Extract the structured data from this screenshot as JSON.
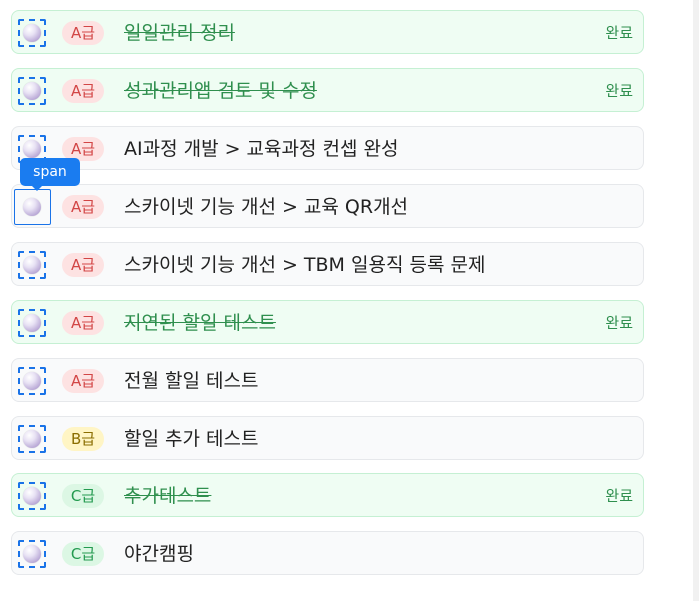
{
  "tooltip": "span",
  "tasks": [
    {
      "grade": "A급",
      "title": "일일관리 정리",
      "status": "완료",
      "done": true
    },
    {
      "grade": "A급",
      "title": "성과관리앱 검토 및 수정",
      "status": "완료",
      "done": true
    },
    {
      "grade": "A급",
      "title": "AI과정 개발 > 교육과정 컨셉 완성",
      "status": "",
      "done": false
    },
    {
      "grade": "A급",
      "title": "스카이넷 기능 개선 > 교육 QR개선",
      "status": "",
      "done": false
    },
    {
      "grade": "A급",
      "title": "스카이넷 기능 개선 > TBM 일용직 등록 문제",
      "status": "",
      "done": false
    },
    {
      "grade": "A급",
      "title": "지연된 할일 테스트",
      "status": "완료",
      "done": true
    },
    {
      "grade": "A급",
      "title": "전월 할일 테스트",
      "status": "",
      "done": false
    },
    {
      "grade": "B급",
      "title": "할일 추가 테스트",
      "status": "",
      "done": false
    },
    {
      "grade": "C급",
      "title": "추가테스트",
      "status": "완료",
      "done": true
    },
    {
      "grade": "C급",
      "title": "야간캠핑",
      "status": "",
      "done": false
    }
  ]
}
